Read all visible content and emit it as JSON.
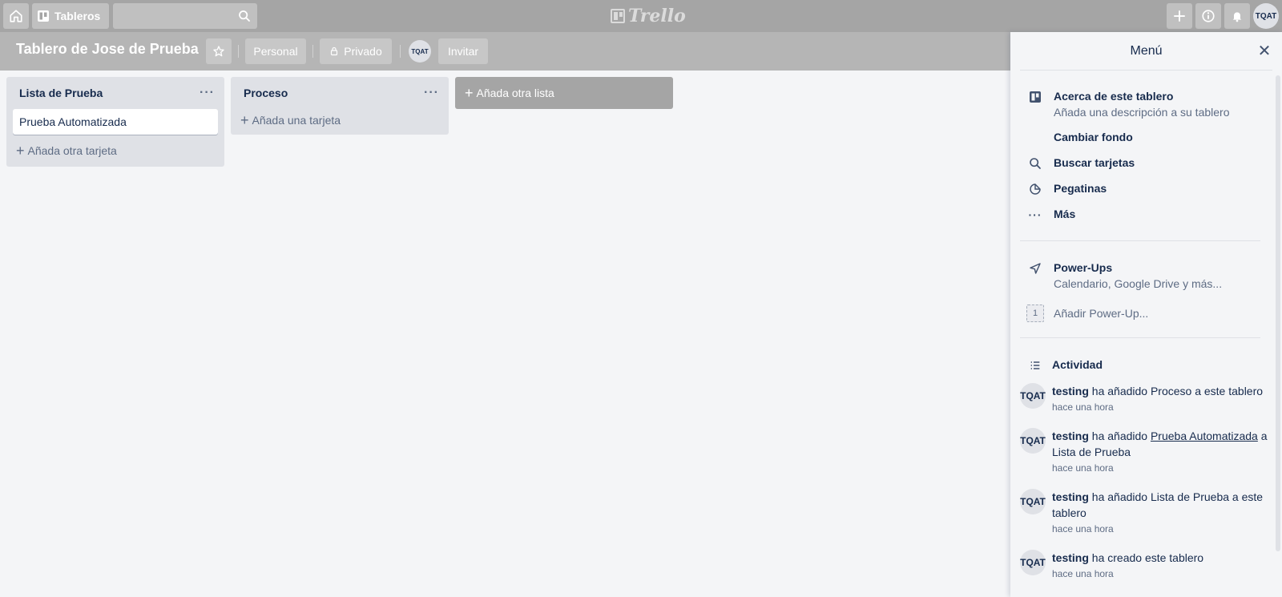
{
  "topbar": {
    "boards_label": "Tableros",
    "search_placeholder": "",
    "logo_text": "Trello",
    "avatar_initials": "TQAT"
  },
  "board": {
    "title": "Tablero de Jose de Prueba",
    "team_label": "Personal",
    "visibility_label": "Privado",
    "member_initials": "TQAT",
    "invite_label": "Invitar"
  },
  "lists": [
    {
      "title": "Lista de Prueba",
      "cards": [
        "Prueba Automatizada"
      ],
      "add_card_label": "Añada otra tarjeta"
    },
    {
      "title": "Proceso",
      "cards": [],
      "add_card_label": "Añada una tarjeta"
    }
  ],
  "add_list_label": "Añada otra lista",
  "menu": {
    "title": "Menú",
    "about": {
      "title": "Acerca de este tablero",
      "subtitle": "Añada una descripción a su tablero"
    },
    "change_background": "Cambiar fondo",
    "search_cards": "Buscar tarjetas",
    "stickers": "Pegatinas",
    "more": "Más",
    "powerups": {
      "title": "Power-Ups",
      "subtitle": "Calendario, Google Drive y más...",
      "badge": "1",
      "add_label": "Añadir Power-Up..."
    },
    "activity_title": "Actividad",
    "activity": [
      {
        "avatar": "TQAT",
        "user": "testing",
        "pre": " ha añadido Proceso a este tablero",
        "link": "",
        "post": "",
        "time": "hace una hora"
      },
      {
        "avatar": "TQAT",
        "user": "testing",
        "pre": " ha añadido ",
        "link": "Prueba Automatizada",
        "post": " a Lista de Prueba",
        "time": "hace una hora"
      },
      {
        "avatar": "TQAT",
        "user": "testing",
        "pre": " ha añadido Lista de Prueba a este tablero",
        "link": "",
        "post": "",
        "time": "hace una hora"
      },
      {
        "avatar": "TQAT",
        "user": "testing",
        "pre": " ha creado este tablero",
        "link": "",
        "post": "",
        "time": "hace una hora"
      }
    ]
  },
  "colors": {
    "topbar": "#a5a5a5",
    "boardbar": "#b5b5b5",
    "board_bg": "#f4f5f7",
    "list_bg": "#dfe1e6",
    "text": "#172b4d"
  }
}
